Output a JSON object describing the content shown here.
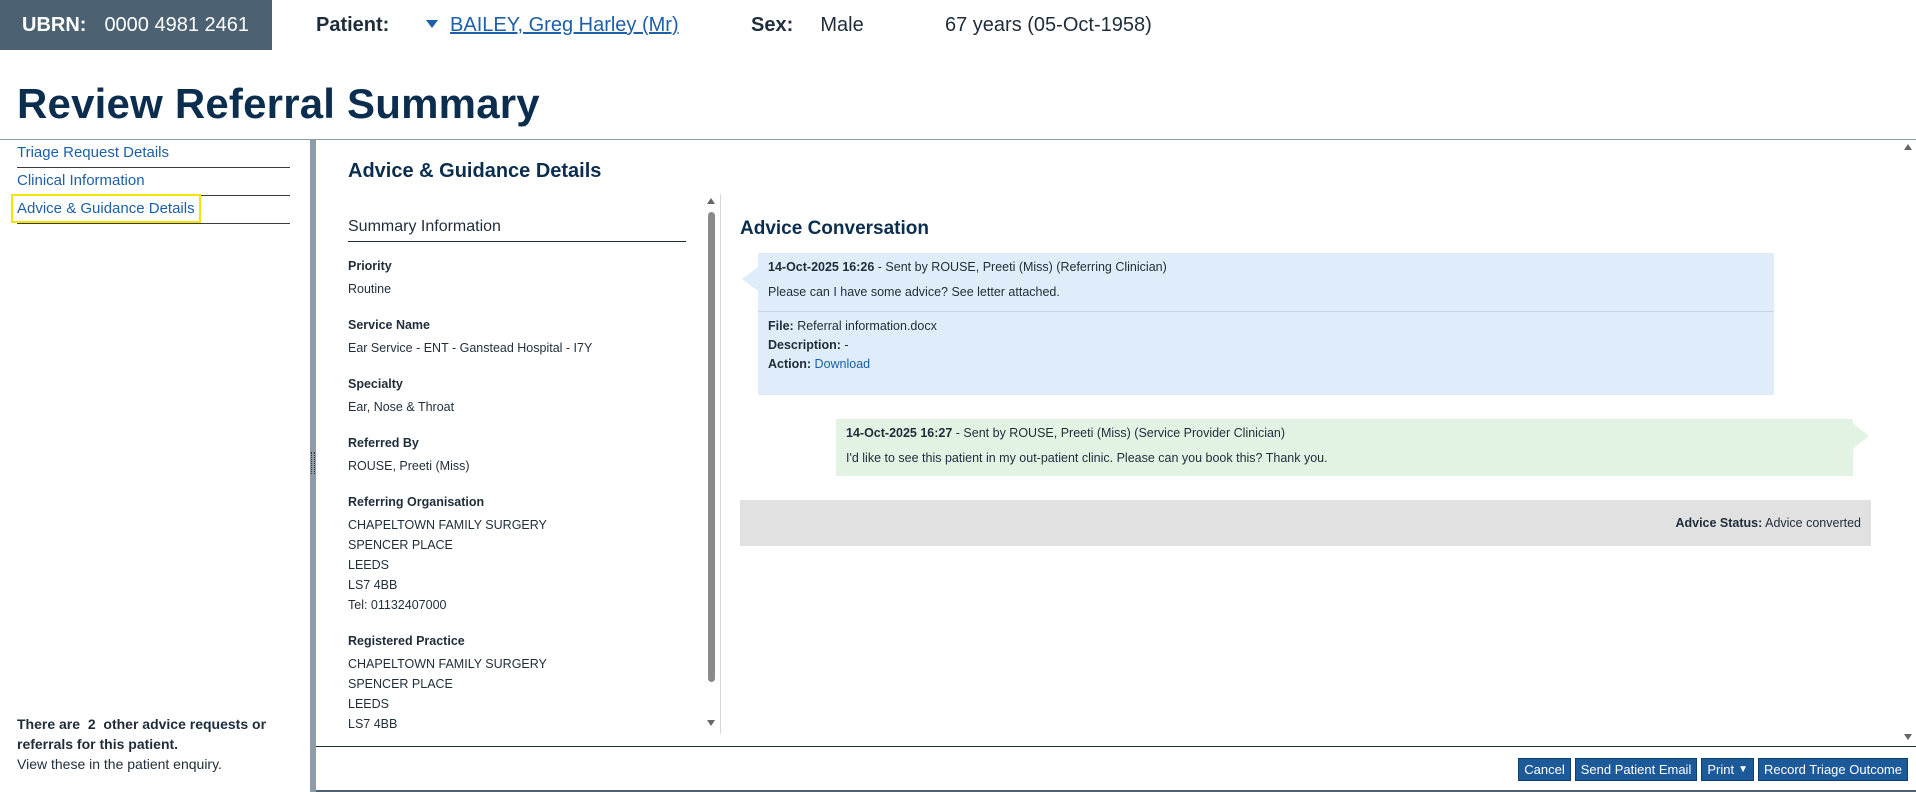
{
  "header": {
    "ubrn_label": "UBRN:",
    "ubrn_value": "0000 4981 2461",
    "patient_label": "Patient:",
    "patient_name": "BAILEY, Greg Harley (Mr)",
    "sex_label": "Sex:",
    "sex_value": "Male",
    "age_dob": "67 years (05-Oct-1958)"
  },
  "page_title": "Review Referral Summary",
  "nav": {
    "items": [
      {
        "label": "Triage Request Details"
      },
      {
        "label": "Clinical Information"
      },
      {
        "label": "Advice & Guidance Details"
      }
    ],
    "selected_index": 2,
    "note_prefix": "There are",
    "note_count": "2",
    "note_suffix": "other advice requests or referrals for this patient.",
    "note_line2": "View these in the patient enquiry."
  },
  "section_title": "Advice & Guidance Details",
  "summary": {
    "heading": "Summary Information",
    "fields": [
      {
        "label": "Priority",
        "value": "Routine"
      },
      {
        "label": "Service Name",
        "value": "Ear Service - ENT - Ganstead Hospital - I7Y"
      },
      {
        "label": "Specialty",
        "value": "Ear, Nose & Throat"
      },
      {
        "label": "Referred By",
        "value": "ROUSE, Preeti (Miss)"
      },
      {
        "label": "Referring Organisation",
        "lines": [
          "CHAPELTOWN FAMILY SURGERY",
          "SPENCER PLACE",
          "LEEDS",
          "LS7 4BB",
          "Tel: 01132407000"
        ]
      },
      {
        "label": "Registered Practice",
        "lines": [
          "CHAPELTOWN FAMILY SURGERY",
          "SPENCER PLACE",
          "LEEDS",
          "LS7 4BB"
        ]
      }
    ]
  },
  "conversation": {
    "title": "Advice Conversation",
    "messages": [
      {
        "timestamp": "14-Oct-2025 16:26",
        "sender": " - Sent by ROUSE, Preeti (Miss) (Referring Clinician)",
        "body": "Please can I have some advice? See letter attached.",
        "file_label": "File:",
        "file_value": "Referral information.docx",
        "description_label": "Description:",
        "description_value": "-",
        "action_label": "Action:",
        "action_value": "Download"
      },
      {
        "timestamp": "14-Oct-2025 16:27",
        "sender": " - Sent by ROUSE, Preeti (Miss) (Service Provider Clinician)",
        "body": "I'd like to see this patient in my out-patient clinic. Please can you book this? Thank you."
      }
    ],
    "status_label": "Advice Status:",
    "status_value": "Advice converted"
  },
  "buttons": {
    "cancel": "Cancel",
    "send_email": "Send Patient Email",
    "print": "Print",
    "record_outcome": "Record Triage Outcome"
  },
  "colors": {
    "header_bg": "#4c6272",
    "title": "#0b2e4f",
    "link": "#1d5fa8",
    "incoming_bg": "#deedf9",
    "outgoing_bg": "#e3f3e3",
    "status_bg": "#e1e1e1",
    "button_bg": "#1d5a9a",
    "highlight": "#f2e600"
  }
}
